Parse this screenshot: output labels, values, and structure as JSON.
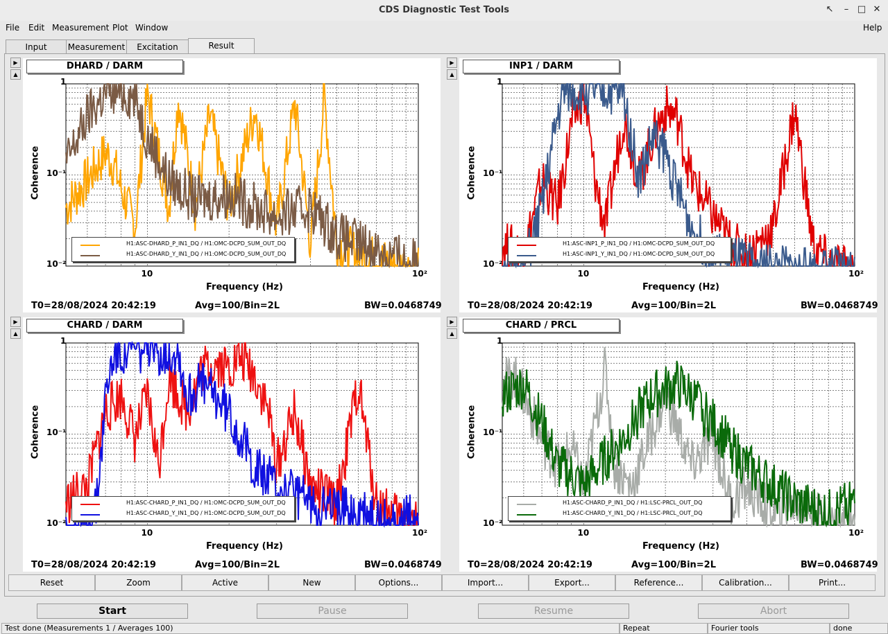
{
  "window": {
    "title": "CDS Diagnostic Test Tools"
  },
  "menu": [
    "File",
    "Edit",
    "Measurement",
    "Plot",
    "Window"
  ],
  "menu_help": "Help",
  "tabs": [
    {
      "label": "Input"
    },
    {
      "label": "Measurement"
    },
    {
      "label": "Excitation"
    },
    {
      "label": "Result",
      "active": true
    }
  ],
  "plots": [
    {
      "title": "DHARD / DARM",
      "ylabel": "Coherence",
      "xlabel": "Frequency (Hz)",
      "legend": [
        {
          "label": "H1:ASC-DHARD_P_IN1_DQ / H1:OMC-DCPD_SUM_OUT_DQ",
          "color": "#ffa500"
        },
        {
          "label": "H1:ASC-DHARD_Y_IN1_DQ / H1:OMC-DCPD_SUM_OUT_DQ",
          "color": "#7b5b45"
        }
      ],
      "t0": "T0=28/08/2024 20:42:19",
      "avg": "Avg=100/Bin=2L",
      "bw": "BW=0.0468749"
    },
    {
      "title": "INP1 / DARM",
      "ylabel": "Coherence",
      "xlabel": "Frequency (Hz)",
      "legend": [
        {
          "label": "H1:ASC-INP1_P_IN1_DQ / H1:OMC-DCPD_SUM_OUT_DQ",
          "color": "#e00000"
        },
        {
          "label": "H1:ASC-INP1_Y_IN1_DQ / H1:OMC-DCPD_SUM_OUT_DQ",
          "color": "#3a5a8c"
        }
      ],
      "t0": "T0=28/08/2024 20:42:19",
      "avg": "Avg=100/Bin=2L",
      "bw": "BW=0.0468749"
    },
    {
      "title": "CHARD / DARM",
      "ylabel": "Coherence",
      "xlabel": "Frequency (Hz)",
      "legend": [
        {
          "label": "H1:ASC-CHARD_P_IN1_DQ / H1:OMC-DCPD_SUM_OUT_DQ",
          "color": "#ee1111"
        },
        {
          "label": "H1:ASC-CHARD_Y_IN1_DQ / H1:OMC-DCPD_SUM_OUT_DQ",
          "color": "#1010e0"
        }
      ],
      "t0": "T0=28/08/2024 20:42:19",
      "avg": "Avg=100/Bin=2L",
      "bw": "BW=0.0468749"
    },
    {
      "title": "CHARD / PRCL",
      "ylabel": "Coherence",
      "xlabel": "Frequency (Hz)",
      "legend": [
        {
          "label": "H1:ASC-CHARD_P_IN1_DQ / H1:LSC-PRCL_OUT_DQ",
          "color": "#a8aca8"
        },
        {
          "label": "H1:ASC-CHARD_Y_IN1_DQ / H1:LSC-PRCL_OUT_DQ",
          "color": "#0a6a0a"
        }
      ],
      "t0": "T0=28/08/2024 20:42:19",
      "avg": "Avg=100/Bin=2L",
      "bw": "BW=0.0468749"
    }
  ],
  "axis": {
    "y_ticks": [
      "1",
      "10⁻¹",
      "10⁻²"
    ],
    "x_ticks": [
      "10",
      "10²"
    ]
  },
  "chart_data": [
    {
      "type": "line",
      "title": "DHARD / DARM",
      "xlabel": "Frequency (Hz)",
      "ylabel": "Coherence",
      "xscale": "log",
      "yscale": "log",
      "xlim": [
        5,
        100
      ],
      "ylim": [
        0.01,
        1
      ],
      "series": [
        {
          "name": "H1:ASC-DHARD_P_IN1_DQ / H1:OMC-DCPD_SUM_OUT_DQ",
          "color": "#ffa500",
          "points": [
            [
              5,
              0.05
            ],
            [
              6,
              0.1
            ],
            [
              7,
              0.2
            ],
            [
              7.5,
              0.15
            ],
            [
              8,
              0.08
            ],
            [
              9,
              0.03
            ],
            [
              10,
              0.9
            ],
            [
              11,
              0.2
            ],
            [
              12,
              0.05
            ],
            [
              13,
              0.8
            ],
            [
              15,
              0.05
            ],
            [
              17,
              0.5
            ],
            [
              20,
              0.05
            ],
            [
              25,
              0.6
            ],
            [
              30,
              0.03
            ],
            [
              35,
              0.7
            ],
            [
              40,
              0.02
            ],
            [
              45,
              0.8
            ],
            [
              50,
              0.02
            ],
            [
              60,
              0.015
            ],
            [
              80,
              0.012
            ],
            [
              100,
              0.01
            ]
          ]
        },
        {
          "name": "H1:ASC-DHARD_Y_IN1_DQ / H1:OMC-DCPD_SUM_OUT_DQ",
          "color": "#7b5b45",
          "points": [
            [
              5,
              0.15
            ],
            [
              6,
              0.5
            ],
            [
              7,
              0.9
            ],
            [
              8,
              0.95
            ],
            [
              9,
              0.8
            ],
            [
              10,
              0.3
            ],
            [
              12,
              0.1
            ],
            [
              15,
              0.06
            ],
            [
              20,
              0.07
            ],
            [
              25,
              0.05
            ],
            [
              30,
              0.04
            ],
            [
              40,
              0.05
            ],
            [
              50,
              0.025
            ],
            [
              60,
              0.02
            ],
            [
              80,
              0.015
            ],
            [
              100,
              0.012
            ]
          ]
        }
      ]
    },
    {
      "type": "line",
      "title": "INP1 / DARM",
      "xlabel": "Frequency (Hz)",
      "ylabel": "Coherence",
      "xscale": "log",
      "yscale": "log",
      "xlim": [
        5,
        100
      ],
      "ylim": [
        0.01,
        1
      ],
      "series": [
        {
          "name": "H1:ASC-INP1_P_IN1_DQ / H1:OMC-DCPD_SUM_OUT_DQ",
          "color": "#e00000",
          "points": [
            [
              5,
              0.02
            ],
            [
              6,
              0.015
            ],
            [
              7,
              0.1
            ],
            [
              8,
              0.05
            ],
            [
              9,
              0.4
            ],
            [
              10,
              0.9
            ],
            [
              11,
              0.1
            ],
            [
              12,
              0.03
            ],
            [
              14,
              0.5
            ],
            [
              16,
              0.1
            ],
            [
              18,
              0.3
            ],
            [
              20,
              0.6
            ],
            [
              22,
              0.5
            ],
            [
              25,
              0.1
            ],
            [
              30,
              0.04
            ],
            [
              35,
              0.02
            ],
            [
              40,
              0.015
            ],
            [
              50,
              0.03
            ],
            [
              60,
              0.6
            ],
            [
              70,
              0.02
            ],
            [
              80,
              0.012
            ],
            [
              100,
              0.01
            ]
          ]
        },
        {
          "name": "H1:ASC-INP1_Y_IN1_DQ / H1:OMC-DCPD_SUM_OUT_DQ",
          "color": "#3a5a8c",
          "points": [
            [
              6,
              0.01
            ],
            [
              7,
              0.05
            ],
            [
              8,
              0.5
            ],
            [
              8.5,
              0.95
            ],
            [
              10,
              0.95
            ],
            [
              12,
              0.95
            ],
            [
              14,
              0.9
            ],
            [
              15,
              0.3
            ],
            [
              16,
              0.1
            ],
            [
              18,
              0.3
            ],
            [
              20,
              0.2
            ],
            [
              22,
              0.08
            ],
            [
              25,
              0.03
            ],
            [
              30,
              0.015
            ],
            [
              40,
              0.012
            ],
            [
              60,
              0.01
            ],
            [
              100,
              0.01
            ]
          ]
        }
      ]
    },
    {
      "type": "line",
      "title": "CHARD / DARM",
      "xlabel": "Frequency (Hz)",
      "ylabel": "Coherence",
      "xscale": "log",
      "yscale": "log",
      "xlim": [
        5,
        100
      ],
      "ylim": [
        0.01,
        1
      ],
      "series": [
        {
          "name": "H1:ASC-CHARD_P_IN1_DQ / H1:OMC-DCPD_SUM_OUT_DQ",
          "color": "#ee1111",
          "points": [
            [
              5,
              0.02
            ],
            [
              6,
              0.03
            ],
            [
              7,
              0.2
            ],
            [
              8,
              0.3
            ],
            [
              9,
              0.1
            ],
            [
              10,
              0.3
            ],
            [
              11,
              0.05
            ],
            [
              12,
              0.5
            ],
            [
              14,
              0.2
            ],
            [
              16,
              0.6
            ],
            [
              18,
              0.7
            ],
            [
              20,
              0.6
            ],
            [
              22,
              0.8
            ],
            [
              25,
              0.5
            ],
            [
              28,
              0.2
            ],
            [
              30,
              0.05
            ],
            [
              35,
              0.2
            ],
            [
              40,
              0.03
            ],
            [
              50,
              0.02
            ],
            [
              60,
              0.4
            ],
            [
              70,
              0.02
            ],
            [
              80,
              0.015
            ],
            [
              100,
              0.012
            ]
          ]
        },
        {
          "name": "H1:ASC-CHARD_Y_IN1_DQ / H1:OMC-DCPD_SUM_OUT_DQ",
          "color": "#1010e0",
          "points": [
            [
              6,
              0.01
            ],
            [
              6.5,
              0.02
            ],
            [
              7,
              0.3
            ],
            [
              7.5,
              0.9
            ],
            [
              9,
              0.95
            ],
            [
              10,
              0.9
            ],
            [
              11,
              0.95
            ],
            [
              13,
              0.95
            ],
            [
              14,
              0.3
            ],
            [
              16,
              0.4
            ],
            [
              18,
              0.3
            ],
            [
              20,
              0.2
            ],
            [
              25,
              0.05
            ],
            [
              30,
              0.03
            ],
            [
              40,
              0.02
            ],
            [
              60,
              0.015
            ],
            [
              80,
              0.012
            ],
            [
              100,
              0.015
            ]
          ]
        }
      ]
    },
    {
      "type": "line",
      "title": "CHARD / PRCL",
      "xlabel": "Frequency (Hz)",
      "ylabel": "Coherence",
      "xscale": "log",
      "yscale": "log",
      "xlim": [
        5,
        100
      ],
      "ylim": [
        0.01,
        1
      ],
      "series": [
        {
          "name": "H1:ASC-CHARD_P_IN1_DQ / H1:LSC-PRCL_OUT_DQ",
          "color": "#a8aca8",
          "points": [
            [
              5,
              0.4
            ],
            [
              5.5,
              0.5
            ],
            [
              6,
              0.3
            ],
            [
              7,
              0.1
            ],
            [
              8,
              0.05
            ],
            [
              9,
              0.08
            ],
            [
              10,
              0.03
            ],
            [
              12,
              0.6
            ],
            [
              13,
              0.05
            ],
            [
              15,
              0.03
            ],
            [
              20,
              0.3
            ],
            [
              25,
              0.05
            ],
            [
              30,
              0.1
            ],
            [
              35,
              0.02
            ],
            [
              40,
              0.03
            ],
            [
              50,
              0.015
            ],
            [
              60,
              0.02
            ],
            [
              80,
              0.012
            ],
            [
              100,
              0.01
            ]
          ]
        },
        {
          "name": "H1:ASC-CHARD_Y_IN1_DQ / H1:LSC-PRCL_OUT_DQ",
          "color": "#0a6a0a",
          "points": [
            [
              5,
              0.3
            ],
            [
              6,
              0.4
            ],
            [
              7,
              0.15
            ],
            [
              8,
              0.05
            ],
            [
              9,
              0.04
            ],
            [
              10,
              0.03
            ],
            [
              12,
              0.06
            ],
            [
              14,
              0.1
            ],
            [
              16,
              0.2
            ],
            [
              18,
              0.3
            ],
            [
              20,
              0.35
            ],
            [
              22,
              0.4
            ],
            [
              25,
              0.3
            ],
            [
              30,
              0.15
            ],
            [
              35,
              0.08
            ],
            [
              40,
              0.05
            ],
            [
              50,
              0.03
            ],
            [
              60,
              0.02
            ],
            [
              80,
              0.015
            ],
            [
              100,
              0.02
            ]
          ]
        }
      ]
    }
  ],
  "toolbar": [
    "Reset",
    "Zoom",
    "Active",
    "New",
    "Options...",
    "Import...",
    "Export...",
    "Reference...",
    "Calibration...",
    "Print..."
  ],
  "controls": [
    {
      "label": "Start",
      "enabled": true
    },
    {
      "label": "Pause",
      "enabled": false
    },
    {
      "label": "Resume",
      "enabled": false
    },
    {
      "label": "Abort",
      "enabled": false
    }
  ],
  "status": {
    "message": "Test done (Measurements 1 / Averages 100)",
    "mode": "Repeat",
    "tool": "Fourier tools",
    "state": "done"
  }
}
